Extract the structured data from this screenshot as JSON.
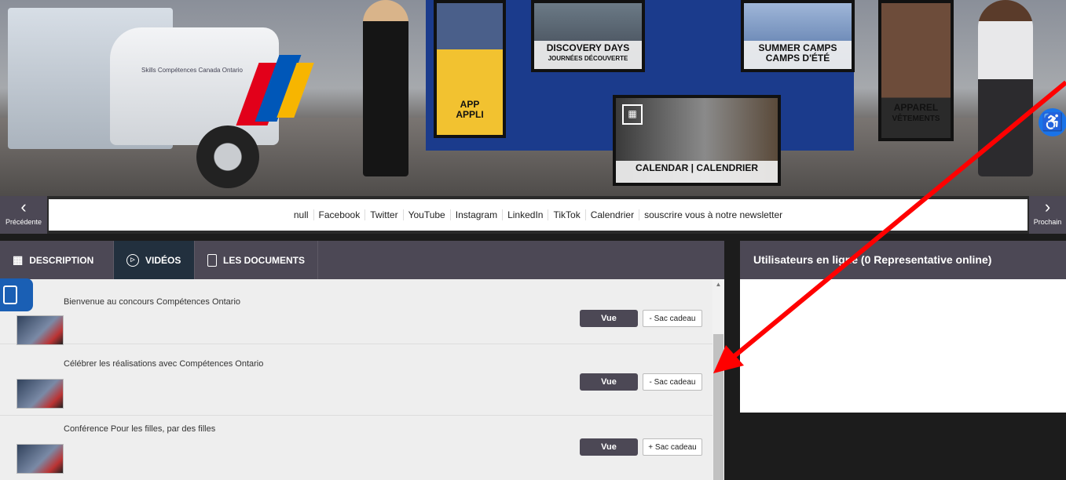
{
  "booth": {
    "truck_logo": "Skills Compétences Canada Ontario",
    "panels": [
      {
        "id": "app",
        "title": "APP",
        "subtitle": "APPLI"
      },
      {
        "id": "discovery",
        "title": "DISCOVERY DAYS",
        "subtitle": "JOURNÉES DÉCOUVERTE"
      },
      {
        "id": "camps",
        "title": "SUMMER CAMPS",
        "subtitle": "CAMPS D'ÉTÉ"
      },
      {
        "id": "calendar",
        "title": "CALENDAR | CALENDRIER",
        "subtitle": ""
      },
      {
        "id": "apparel",
        "title": "APPAREL",
        "subtitle": "VÊTEMENTS"
      }
    ]
  },
  "nav": {
    "prev_label": "Précédente",
    "next_label": "Prochain",
    "links": [
      "null",
      "Facebook",
      "Twitter",
      "YouTube",
      "Instagram",
      "LinkedIn",
      "TikTok",
      "Calendrier",
      "souscrire vous à notre newsletter"
    ]
  },
  "tabs": [
    {
      "label": "DESCRIPTION",
      "icon": "building-icon"
    },
    {
      "label": "VIDÉOS",
      "icon": "play-icon"
    },
    {
      "label": "LES DOCUMENTS",
      "icon": "document-icon"
    }
  ],
  "videos": [
    {
      "title": "Bienvenue au concours Compétences Ontario",
      "view_label": "Vue",
      "bag_label": "- Sac cadeau"
    },
    {
      "title": "Célébrer les réalisations avec Compétences Ontario",
      "view_label": "Vue",
      "bag_label": "- Sac cadeau"
    },
    {
      "title": "Conférence Pour les filles, par des filles",
      "view_label": "Vue",
      "bag_label": "+ Sac cadeau"
    }
  ],
  "online": {
    "title": "Utilisateurs en ligne (0 Representative online)"
  },
  "colors": {
    "header_bg": "#4c4855",
    "active_tab": "#22303e",
    "accessibility": "#1a73e8",
    "annotation_arrow": "#ff0000"
  }
}
